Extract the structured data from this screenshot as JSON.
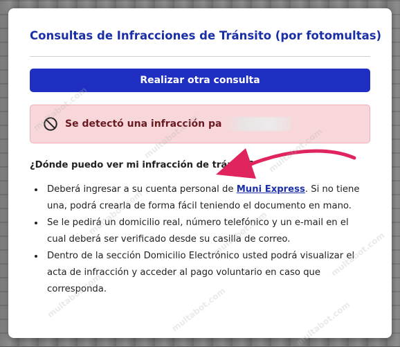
{
  "title": "Consultas de Infracciones de Tránsito (por fotomultas)",
  "button_label": "Realizar otra consulta",
  "alert": {
    "icon": "prohibited-icon",
    "text": "Se detectó una infracción pa"
  },
  "question": "¿Dónde puedo ver mi infracción de tráns",
  "question_tail": "?",
  "list": {
    "item1_before": "Deberá ingresar a su cuenta personal de ",
    "item1_link": "Muni Express",
    "item1_after": ". Si no tiene una, podrá crearla de forma fácil teniendo el documento en mano.",
    "item2": "Se le pedirá un domicilio real, número telefónico y un e-mail en el cual deberá ser verificado desde su casilla de correo.",
    "item3": "Dentro de la sección Domicilio Electrónico usted podrá visualizar el acta de infracción y acceder al pago voluntario en caso que corresponda."
  },
  "watermark": "multabot.com",
  "colors": {
    "accent": "#1a2fa8",
    "button": "#1f2fc2",
    "alert_bg": "#f8d7da",
    "arrow": "#e0245e"
  }
}
